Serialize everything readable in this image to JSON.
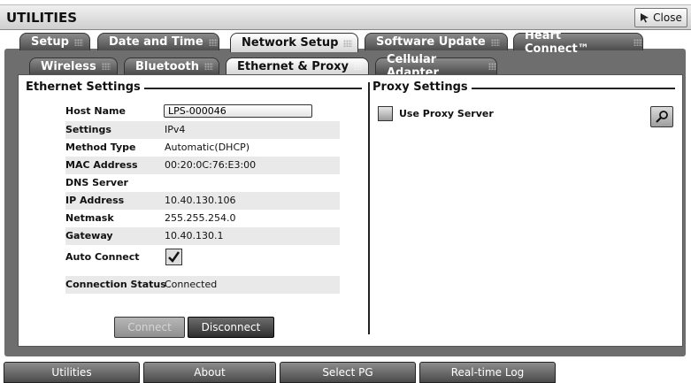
{
  "window": {
    "title": "UTILITIES",
    "close_label": "Close"
  },
  "tabs": [
    {
      "label": "Setup",
      "active": false
    },
    {
      "label": "Date and Time",
      "active": false
    },
    {
      "label": "Network Setup",
      "active": true
    },
    {
      "label": "Software Update",
      "active": false
    },
    {
      "label": "Heart Connect™",
      "active": false
    }
  ],
  "subtabs": [
    {
      "label": "Wireless",
      "active": false
    },
    {
      "label": "Bluetooth",
      "active": false
    },
    {
      "label": "Ethernet & Proxy",
      "active": true
    },
    {
      "label": "Cellular Adapter",
      "active": false
    }
  ],
  "ethernet": {
    "title": "Ethernet Settings",
    "host_name": {
      "label": "Host Name",
      "value": "LPS-000046"
    },
    "rows": [
      {
        "label": "Settings",
        "value": "IPv4"
      },
      {
        "label": "Method Type",
        "value": "Automatic(DHCP)"
      },
      {
        "label": "MAC Address",
        "value": "00:20:0C:76:E3:00"
      },
      {
        "label": "DNS Server",
        "value": ""
      },
      {
        "label": "IP Address",
        "value": "10.40.130.106"
      },
      {
        "label": "Netmask",
        "value": "255.255.254.0"
      },
      {
        "label": "Gateway",
        "value": "10.40.130.1"
      }
    ],
    "auto_connect": {
      "label": "Auto Connect",
      "checked": true
    },
    "connection_status": {
      "label": "Connection Status",
      "value": "Connected"
    },
    "connect_label": "Connect",
    "disconnect_label": "Disconnect"
  },
  "proxy": {
    "title": "Proxy Settings",
    "use_proxy_label": "Use Proxy Server",
    "use_proxy_checked": false,
    "zoom_icon": "magnifier-icon"
  },
  "bottom_nav": [
    {
      "label": "Utilities"
    },
    {
      "label": "About"
    },
    {
      "label": "Select PG"
    },
    {
      "label": "Real-time Log"
    }
  ]
}
